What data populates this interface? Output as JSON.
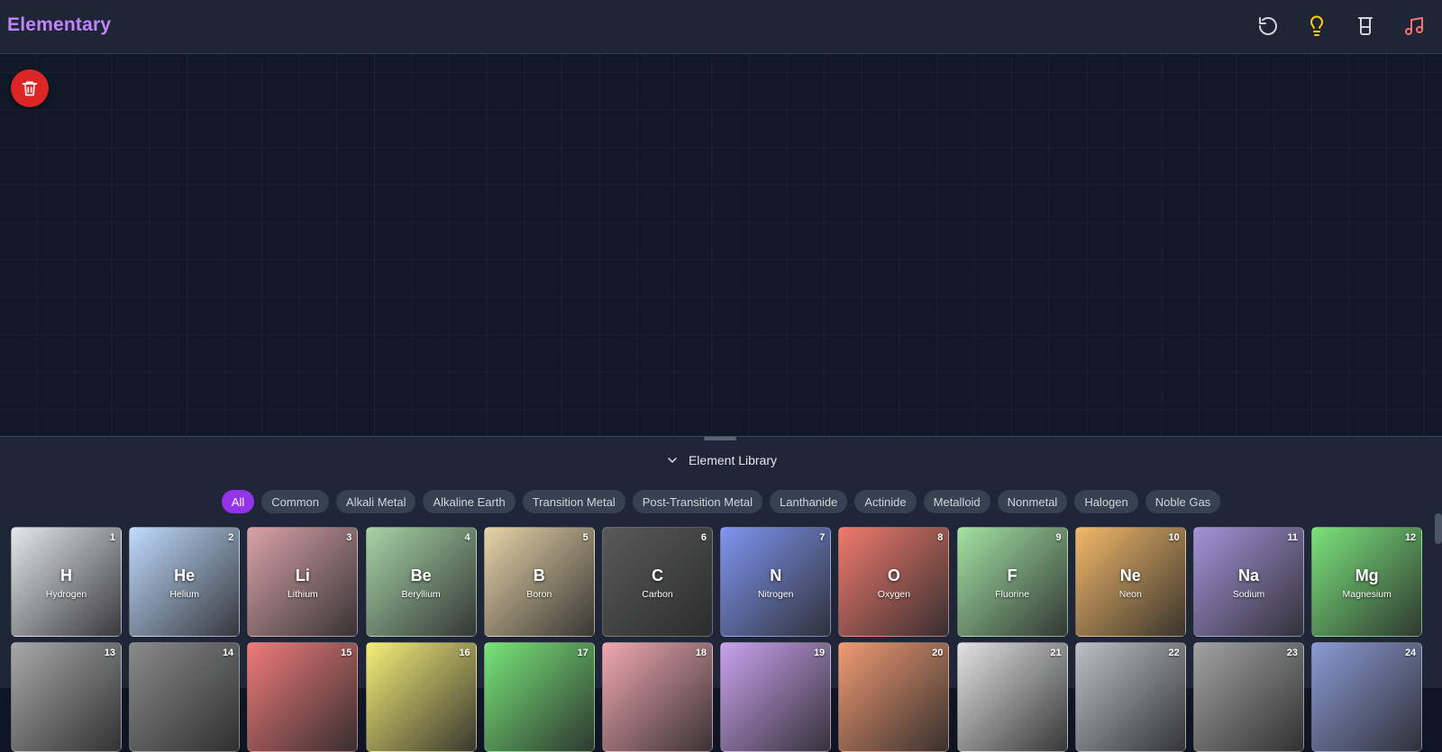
{
  "app": {
    "title": "Elementary"
  },
  "toolbar": {
    "icons": [
      {
        "name": "reset-icon",
        "color": "#d1d5db"
      },
      {
        "name": "lightbulb-icon",
        "color": "#facc15"
      },
      {
        "name": "beaker-icon",
        "color": "#d1d5db"
      },
      {
        "name": "music-icon",
        "color": "#f87171"
      }
    ]
  },
  "canvas": {
    "trash_icon": "trash-icon",
    "trash_color": "#dc2626"
  },
  "library": {
    "title": "Element Library",
    "toggle_icon": "chevron-down-icon",
    "filters": [
      "All",
      "Common",
      "Alkali Metal",
      "Alkaline Earth",
      "Transition Metal",
      "Post-Transition Metal",
      "Lanthanide",
      "Actinide",
      "Metalloid",
      "Nonmetal",
      "Halogen",
      "Noble Gas"
    ],
    "active_filter": "All",
    "elements": [
      {
        "num": "1",
        "sym": "H",
        "name": "Hydrogen",
        "color": "#e5e7eb"
      },
      {
        "num": "2",
        "sym": "He",
        "name": "Helium",
        "color": "#bfdbfe"
      },
      {
        "num": "3",
        "sym": "Li",
        "name": "Lithium",
        "color": "#d9a3a8"
      },
      {
        "num": "4",
        "sym": "Be",
        "name": "Beryllium",
        "color": "#a7d4a7"
      },
      {
        "num": "5",
        "sym": "B",
        "name": "Boron",
        "color": "#e7d3a8"
      },
      {
        "num": "6",
        "sym": "C",
        "name": "Carbon",
        "color": "#5a5a5a"
      },
      {
        "num": "7",
        "sym": "N",
        "name": "Nitrogen",
        "color": "#7f95f0"
      },
      {
        "num": "8",
        "sym": "O",
        "name": "Oxygen",
        "color": "#ef7a6e"
      },
      {
        "num": "9",
        "sym": "F",
        "name": "Fluorine",
        "color": "#a3e2a3"
      },
      {
        "num": "10",
        "sym": "Ne",
        "name": "Neon",
        "color": "#f2b86a"
      },
      {
        "num": "11",
        "sym": "Na",
        "name": "Sodium",
        "color": "#a393d8"
      },
      {
        "num": "12",
        "sym": "Mg",
        "name": "Magnesium",
        "color": "#7be37b"
      },
      {
        "num": "13",
        "sym": "",
        "name": "",
        "color": "#a8a8a8"
      },
      {
        "num": "14",
        "sym": "",
        "name": "",
        "color": "#8a8a8a"
      },
      {
        "num": "15",
        "sym": "",
        "name": "",
        "color": "#ef7a7a"
      },
      {
        "num": "16",
        "sym": "",
        "name": "",
        "color": "#f5ee78"
      },
      {
        "num": "17",
        "sym": "",
        "name": "",
        "color": "#78e578"
      },
      {
        "num": "18",
        "sym": "",
        "name": "",
        "color": "#f0a8b0"
      },
      {
        "num": "19",
        "sym": "",
        "name": "",
        "color": "#c9a2ee"
      },
      {
        "num": "20",
        "sym": "",
        "name": "",
        "color": "#ef9a72"
      },
      {
        "num": "21",
        "sym": "",
        "name": "",
        "color": "#e2e2e2"
      },
      {
        "num": "22",
        "sym": "",
        "name": "",
        "color": "#bcc0c6"
      },
      {
        "num": "23",
        "sym": "",
        "name": "",
        "color": "#a2a2a2"
      },
      {
        "num": "24",
        "sym": "",
        "name": "",
        "color": "#8a9ad4"
      }
    ]
  }
}
